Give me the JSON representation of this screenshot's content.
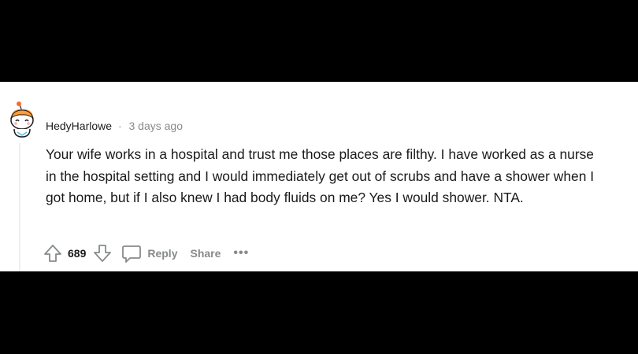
{
  "comment": {
    "author": "HedyHarlowe",
    "separator": "·",
    "time": "3 days ago",
    "body": "Your wife works in a hospital and trust me those places are filthy. I have worked as a nurse in the hospital setting and I would immediately get out of scrubs and have a shower when I got home, but if I also knew I had body fluids on me? Yes I would shower. NTA.",
    "score": "689",
    "reply_label": "Reply",
    "share_label": "Share",
    "more_label": "•••"
  },
  "icons": {
    "avatar": "snoo-avatar-icon",
    "upvote": "upvote-arrow-icon",
    "downvote": "downvote-arrow-icon",
    "reply": "comment-bubble-icon",
    "more": "more-options-icon"
  },
  "colors": {
    "text_primary": "#1a1a1b",
    "text_meta": "#878a8c",
    "card_background": "#ffffff",
    "letterbox": "#000000"
  }
}
